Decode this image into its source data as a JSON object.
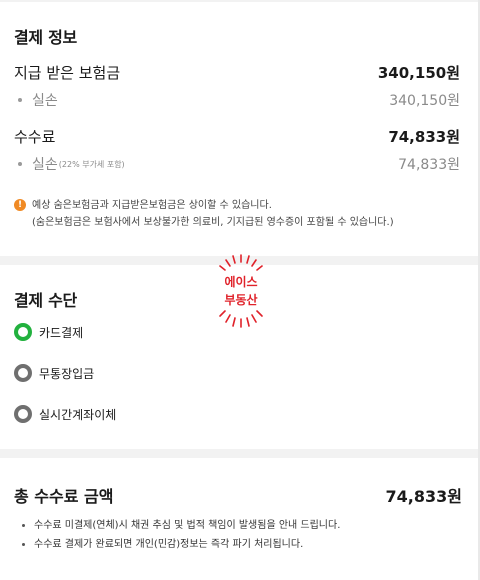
{
  "payment_info": {
    "title": "결제 정보",
    "received": {
      "label": "지급 받은 보험금",
      "value": "340,150원"
    },
    "received_sub": {
      "label": "실손",
      "value": "340,150원"
    },
    "fee": {
      "label": "수수료",
      "value": "74,833원"
    },
    "fee_sub": {
      "label": "실손",
      "note": "(22% 부가세 포함)",
      "value": "74,833원"
    },
    "notice": {
      "line1": "예상 숨은보험금과 지급받은보험금은 상이할 수 있습니다.",
      "line2": "(숨은보험금은 보험사에서 보상불가한 의료비, 기지급된 영수증이 포함될 수 있습니다.)"
    }
  },
  "stamp": {
    "line1": "에이스",
    "line2": "부동산",
    "color": "#e0222a"
  },
  "payment_method": {
    "title": "결제 수단",
    "options": [
      {
        "label": "카드결제",
        "selected": true
      },
      {
        "label": "무통장입금",
        "selected": false
      },
      {
        "label": "실시간계좌이체",
        "selected": false
      }
    ]
  },
  "total": {
    "label": "총 수수료 금액",
    "value": "74,833원",
    "notes": [
      "수수료 미결제(연체)시 채권 추심 및 법적 책임이 발생됨을 안내 드립니다.",
      "수수료 결제가 완료되면 개인(민감)정보는 즉각 파기 처리됩니다."
    ]
  },
  "colors": {
    "selected_radio": "#22b13e",
    "warning": "#f08a24"
  }
}
